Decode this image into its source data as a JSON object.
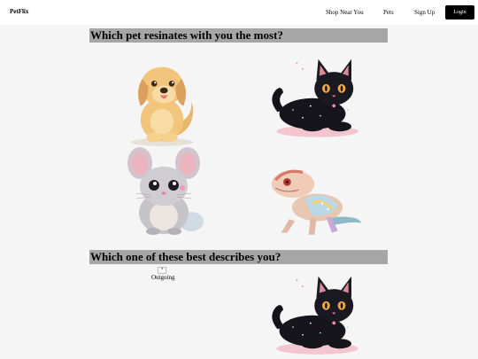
{
  "navbar": {
    "brand": "PetFlix",
    "links": [
      "Shop Near You",
      "Pets",
      "Sign Up"
    ],
    "login": "Login"
  },
  "quiz": {
    "question1": "Which pet resinates with you the most?",
    "question2": "Which one of these best describes you?",
    "q1_options": [
      "dog",
      "cat",
      "chinchilla",
      "lizard"
    ],
    "q2_options": [
      {
        "label": "Outgoing",
        "image_alt": "a",
        "image_status": "broken"
      },
      {
        "image": "cat"
      }
    ]
  }
}
